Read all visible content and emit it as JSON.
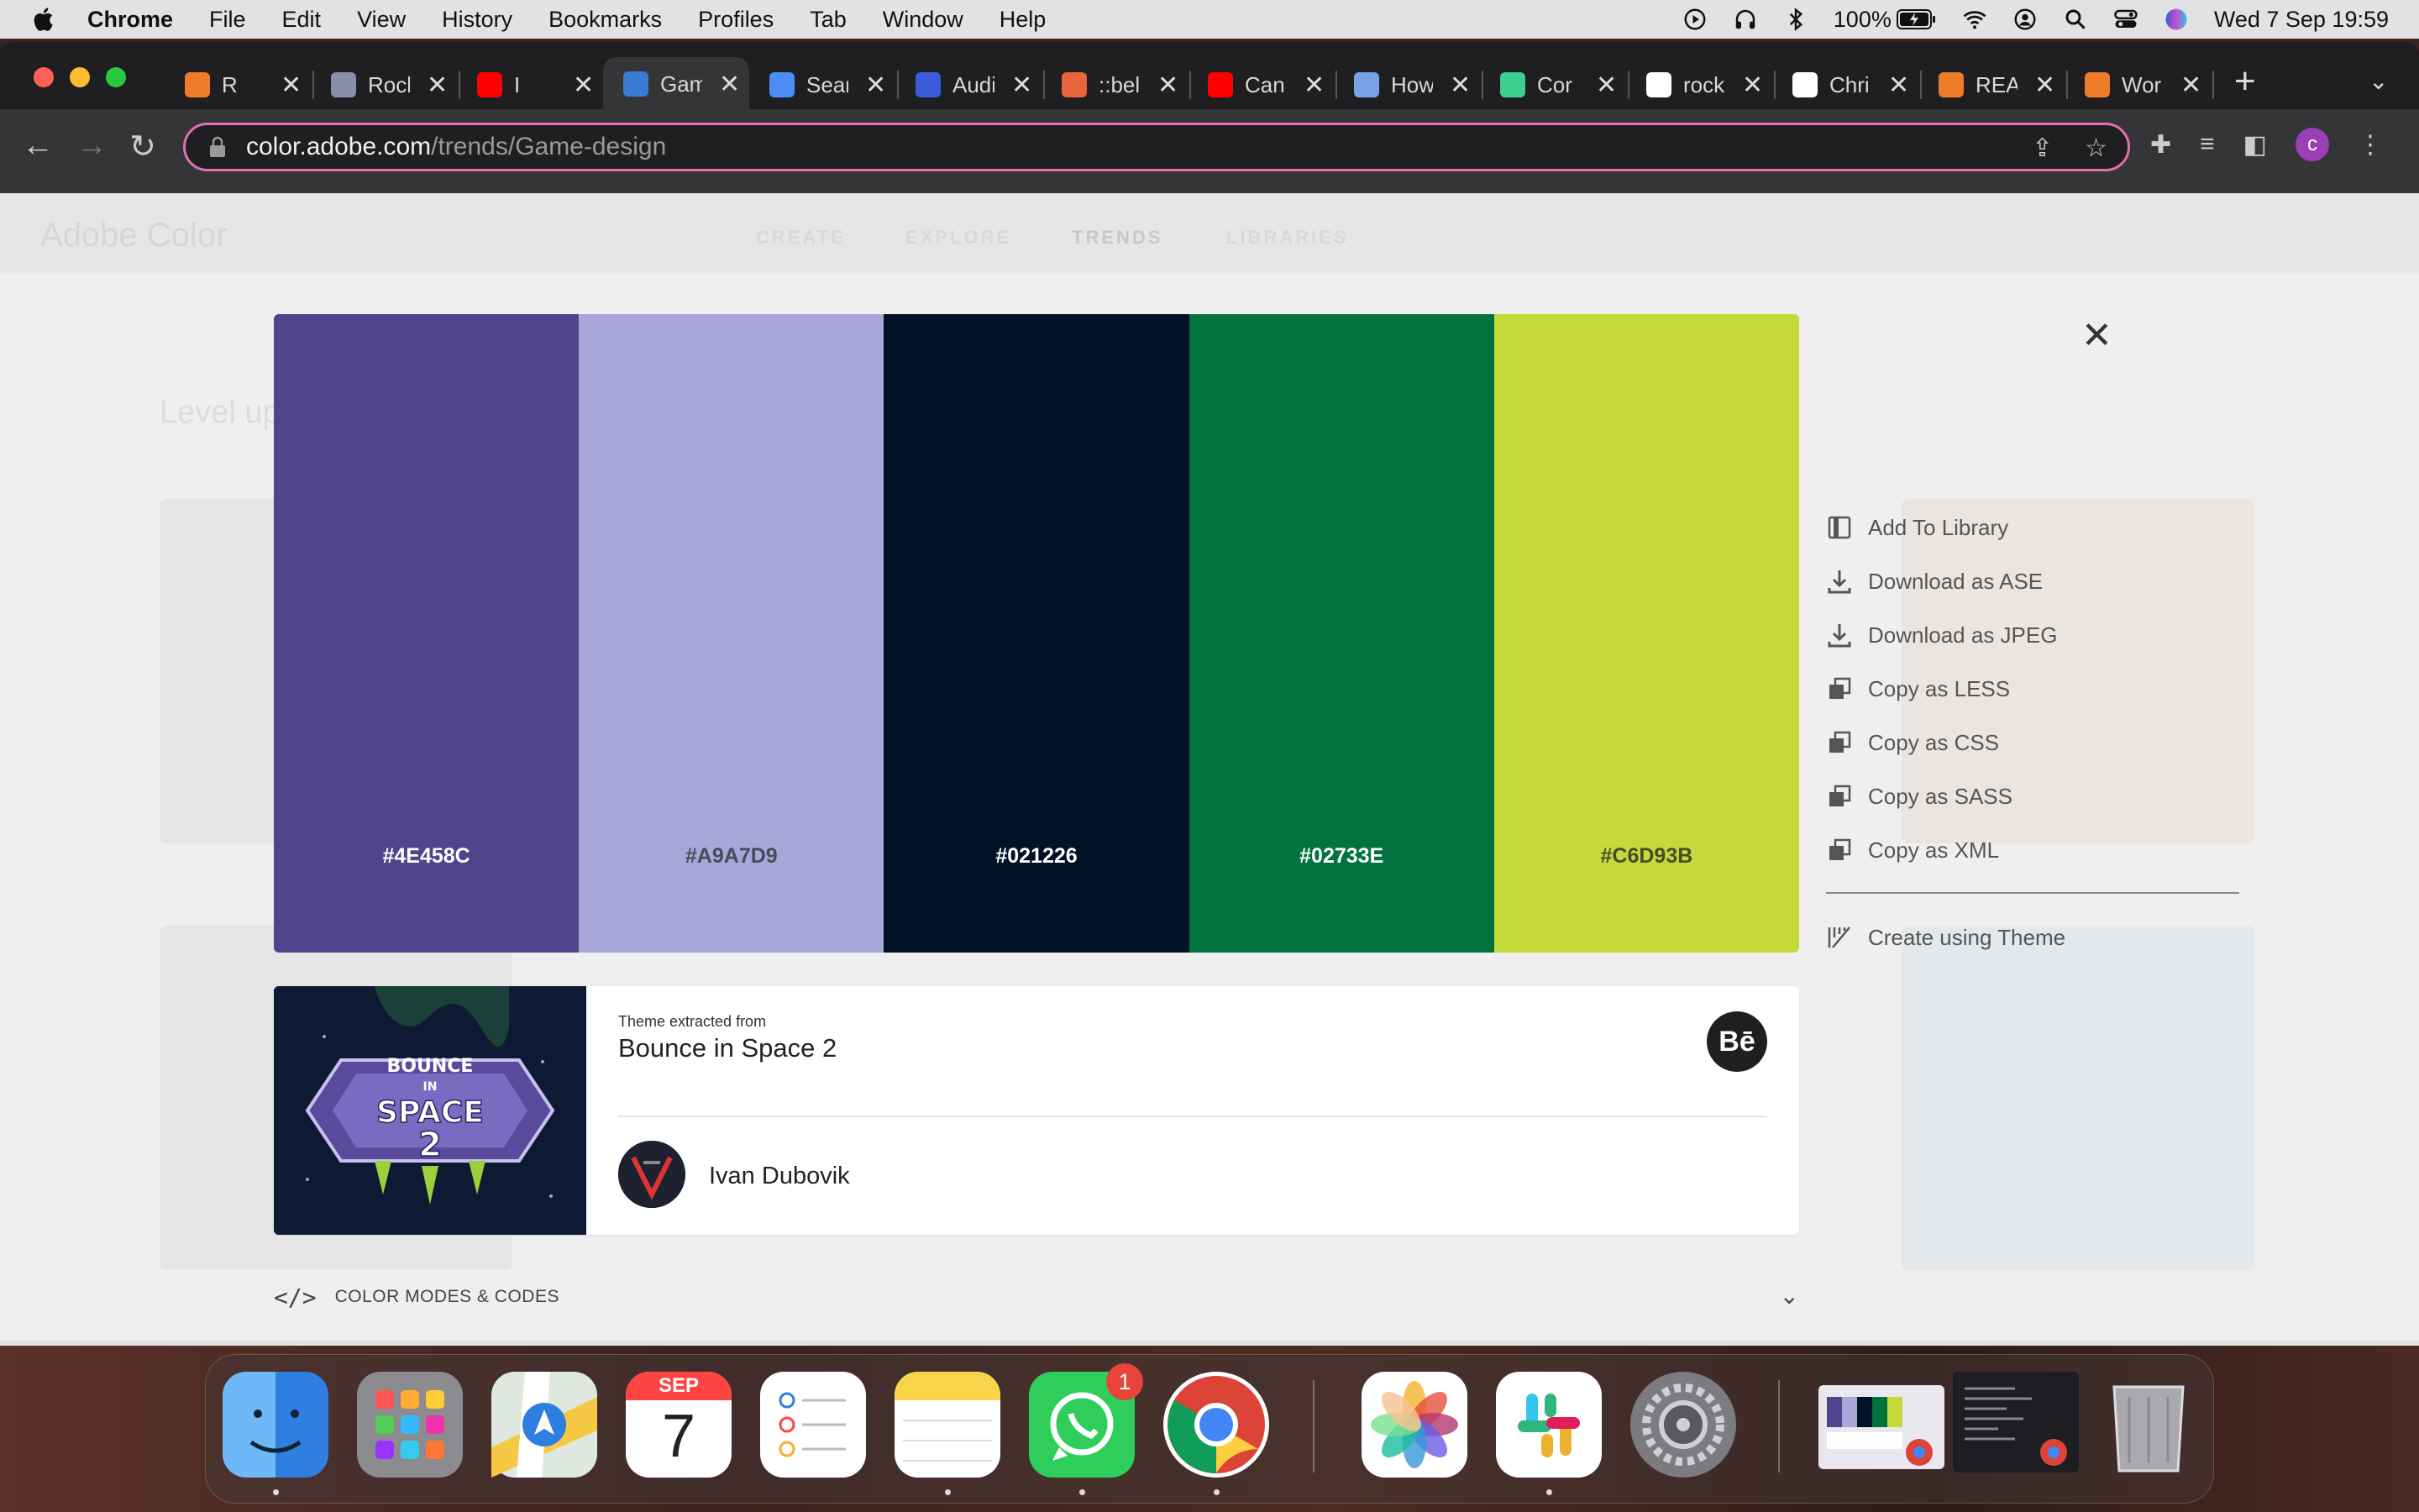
{
  "menubar": {
    "app": "Chrome",
    "items": [
      "File",
      "Edit",
      "View",
      "History",
      "Bookmarks",
      "Profiles",
      "Tab",
      "Window",
      "Help"
    ],
    "battery": "100%",
    "datetime": "Wed 7 Sep  19:59"
  },
  "tabs": [
    {
      "label": "R",
      "icon": "orange-g-icon",
      "color": "#ee7c2a"
    },
    {
      "label": "Rocl",
      "icon": "heart-icon",
      "color": "#8a8fa8"
    },
    {
      "label": "I",
      "icon": "youtube-icon",
      "color": "#ff0000"
    },
    {
      "label": "Gam",
      "icon": "adobe-color-icon",
      "color": "#3a7bd5"
    },
    {
      "label": "Sear",
      "icon": "flag-icon",
      "color": "#4d8df6"
    },
    {
      "label": "Audi",
      "icon": "audi-icon",
      "color": "#3b5bdb"
    },
    {
      "label": "::bel",
      "icon": "asterisk-icon",
      "color": "#e8643a"
    },
    {
      "label": "Can",
      "icon": "youtube-icon",
      "color": "#ff0000"
    },
    {
      "label": "How",
      "icon": "person-icon",
      "color": "#7aa0e8"
    },
    {
      "label": "Cor",
      "icon": "app-icon",
      "color": "#3ccf8e"
    },
    {
      "label": "rock",
      "icon": "github-icon",
      "color": "#ffffff"
    },
    {
      "label": "Chri",
      "icon": "github-icon",
      "color": "#ffffff"
    },
    {
      "label": "REA",
      "icon": "orange-g-icon",
      "color": "#ee7c2a"
    },
    {
      "label": "Wor",
      "icon": "orange-g-icon",
      "color": "#ee7c2a"
    }
  ],
  "address": {
    "domain": "color.adobe.com",
    "path": "/trends/Game-design"
  },
  "background": {
    "logo": "Adobe Color",
    "nav": [
      "CREATE",
      "EXPLORE",
      "TRENDS",
      "LIBRARIES"
    ],
    "title": "Level up"
  },
  "palette": [
    {
      "hex": "#4E458C",
      "label": "#4E458C",
      "text_color": "#ffffff"
    },
    {
      "hex": "#A9A7D9",
      "label": "#A9A7D9",
      "text_color": "#4a4a5a"
    },
    {
      "hex": "#021226",
      "label": "#021226",
      "text_color": "#ffffff"
    },
    {
      "hex": "#02733E",
      "label": "#02733E",
      "text_color": "#ffffff"
    },
    {
      "hex": "#C6D93B",
      "label": "#C6D93B",
      "text_color": "#4a4a2a"
    }
  ],
  "actions": [
    {
      "label": "Add To Library",
      "icon": "library-icon"
    },
    {
      "label": "Download as ASE",
      "icon": "download-icon"
    },
    {
      "label": "Download as JPEG",
      "icon": "download-icon"
    },
    {
      "label": "Copy as LESS",
      "icon": "copy-icon"
    },
    {
      "label": "Copy as CSS",
      "icon": "copy-icon"
    },
    {
      "label": "Copy as SASS",
      "icon": "copy-icon"
    },
    {
      "label": "Copy as XML",
      "icon": "copy-icon"
    }
  ],
  "create_action": {
    "label": "Create using Theme",
    "icon": "wand-icon"
  },
  "source": {
    "extracted_label": "Theme extracted from",
    "title": "Bounce in Space 2",
    "author": "Ivan Dubovik",
    "behance_label": "Bē",
    "thumb_text": [
      "BOUNCE",
      "IN",
      "SPACE",
      "2"
    ]
  },
  "modes": {
    "icon": "</>",
    "label": "COLOR MODES & CODES"
  },
  "dock": {
    "calendar_month": "SEP",
    "calendar_day": "7",
    "whatsapp_badge": "1"
  }
}
